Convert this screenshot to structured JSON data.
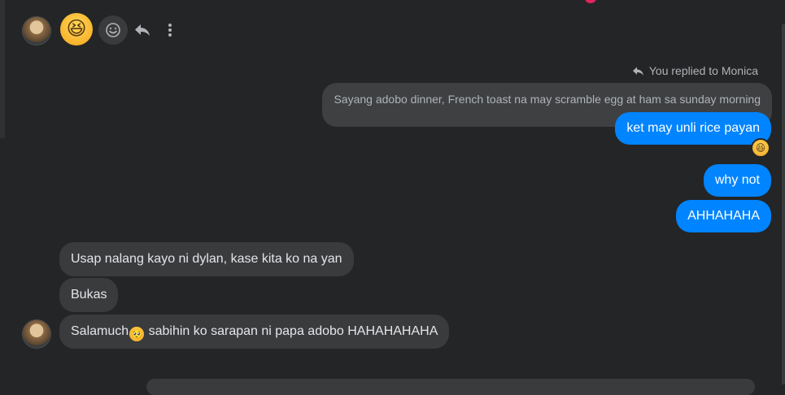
{
  "header": {
    "reaction_emoji": "😆",
    "icons": [
      "smile-icon",
      "reply-icon",
      "more-icon"
    ]
  },
  "reply_context": {
    "label": "You replied to Monica",
    "quoted_text": "Sayang adobo dinner, French toast na may scramble egg at ham sa sunday morning"
  },
  "outgoing": [
    {
      "text": "ket may unli rice payan",
      "reaction": "😆"
    },
    {
      "text": "why not"
    },
    {
      "text": "AHHAHAHA"
    }
  ],
  "incoming": [
    {
      "text": "Usap nalang kayo ni dylan, kase kita ko na yan"
    },
    {
      "text": "Bukas"
    },
    {
      "text_before": "Salamuch",
      "emoji": "🥺",
      "text_after": " sabihin ko sarapan ni papa adobo HAHAHAHAHA"
    }
  ],
  "colors": {
    "background": "#242526",
    "outgoing_bubble": "#0084ff",
    "incoming_bubble": "#3a3b3c",
    "quoted_bubble": "#3e4042"
  }
}
